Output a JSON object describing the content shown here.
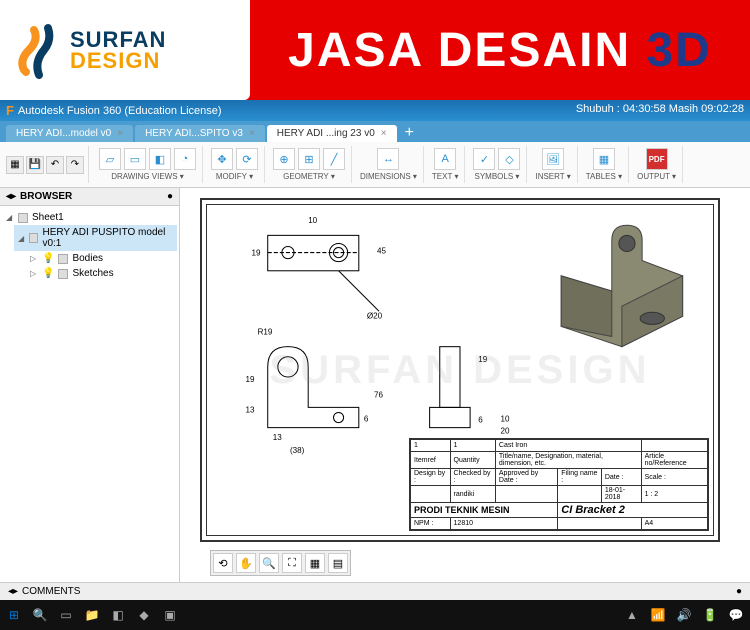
{
  "banner": {
    "logo_line1": "SURFAN",
    "logo_line2": "DESIGN",
    "title_main": "JASA DESAIN",
    "title_3d": "3D"
  },
  "app": {
    "title": "Autodesk Fusion 360 (Education License)",
    "status_right": "Shubuh : 04:30:58  Masih 09:02:28",
    "tabs": [
      {
        "label": "HERY ADI...model v0"
      },
      {
        "label": "HERY ADI...SPITO v3"
      },
      {
        "label": "HERY ADI ...ing 23 v0"
      }
    ],
    "ribbon_groups": [
      {
        "label": "DRAWING VIEWS ▾"
      },
      {
        "label": "MODIFY ▾"
      },
      {
        "label": "GEOMETRY ▾"
      },
      {
        "label": "DIMENSIONS ▾"
      },
      {
        "label": "TEXT ▾"
      },
      {
        "label": "SYMBOLS ▾"
      },
      {
        "label": "INSERT ▾"
      },
      {
        "label": "TABLES ▾"
      },
      {
        "label": "OUTPUT ▾"
      }
    ],
    "browser_title": "BROWSER",
    "tree": {
      "sheet": "Sheet1",
      "model": "HERY ADI PUSPITO model v0:1",
      "bodies": "Bodies",
      "sketches": "Sketches"
    },
    "comments_label": "COMMENTS",
    "watermark": "SURFAN DESIGN"
  },
  "titleblock": {
    "r1c1": "1",
    "r1c2": "1",
    "r1c3": "Cast Iron",
    "r1c4": "",
    "h_item": "Itemref",
    "h_qty": "Quantity",
    "h_desc": "Title/name, Designation, material, dimension, etc.",
    "h_art": "Article no/Reference",
    "design": "Design by :",
    "checked": "Checked by :",
    "approved": "Approved by Date :",
    "filing": "Filing name :",
    "date": "Date :",
    "scale": "Scale :",
    "checked_val": "randiki",
    "date_val": "18-01-2018",
    "scale_val": "1 : 2",
    "org": "PRODI TEKNIK MESIN",
    "partname": "CI Bracket 2",
    "npm": "NPM :",
    "npm_val": "12810",
    "size": "A4"
  },
  "chart_data": {
    "type": "engineering_drawing",
    "views": [
      "top",
      "front",
      "side",
      "isometric"
    ],
    "dimensions": {
      "top_view": {
        "hole_spacing": 10,
        "height": 19,
        "radius_callout": "Ø20",
        "angle_line": 45
      },
      "front_view": {
        "radius": "R19",
        "heights": [
          19,
          13
        ],
        "width_ref": "(38)",
        "width": 13,
        "overall_h": 76,
        "notch": 6
      },
      "side_view": {
        "top_h": 19,
        "bottom_h": 6,
        "base_w": 20,
        "base_t": 10
      }
    }
  }
}
